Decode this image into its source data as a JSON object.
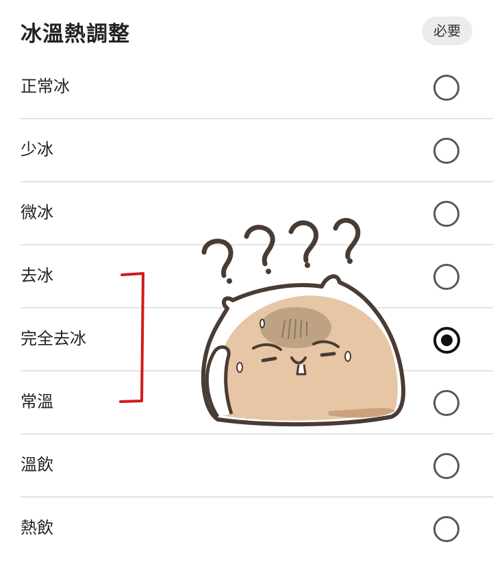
{
  "section": {
    "title": "冰溫熱調整",
    "required_badge": "必要"
  },
  "options": [
    {
      "label": "正常冰",
      "selected": false
    },
    {
      "label": "少冰",
      "selected": false
    },
    {
      "label": "微冰",
      "selected": false
    },
    {
      "label": "去冰",
      "selected": false
    },
    {
      "label": "完全去冰",
      "selected": true
    },
    {
      "label": "常溫",
      "selected": false
    },
    {
      "label": "溫飲",
      "selected": false
    },
    {
      "label": "熱飲",
      "selected": false
    }
  ],
  "annotation": {
    "bracket_color": "#d11a1a",
    "sticker_icon": "confused-hamster-sticker-icon",
    "question_marks": "????"
  }
}
